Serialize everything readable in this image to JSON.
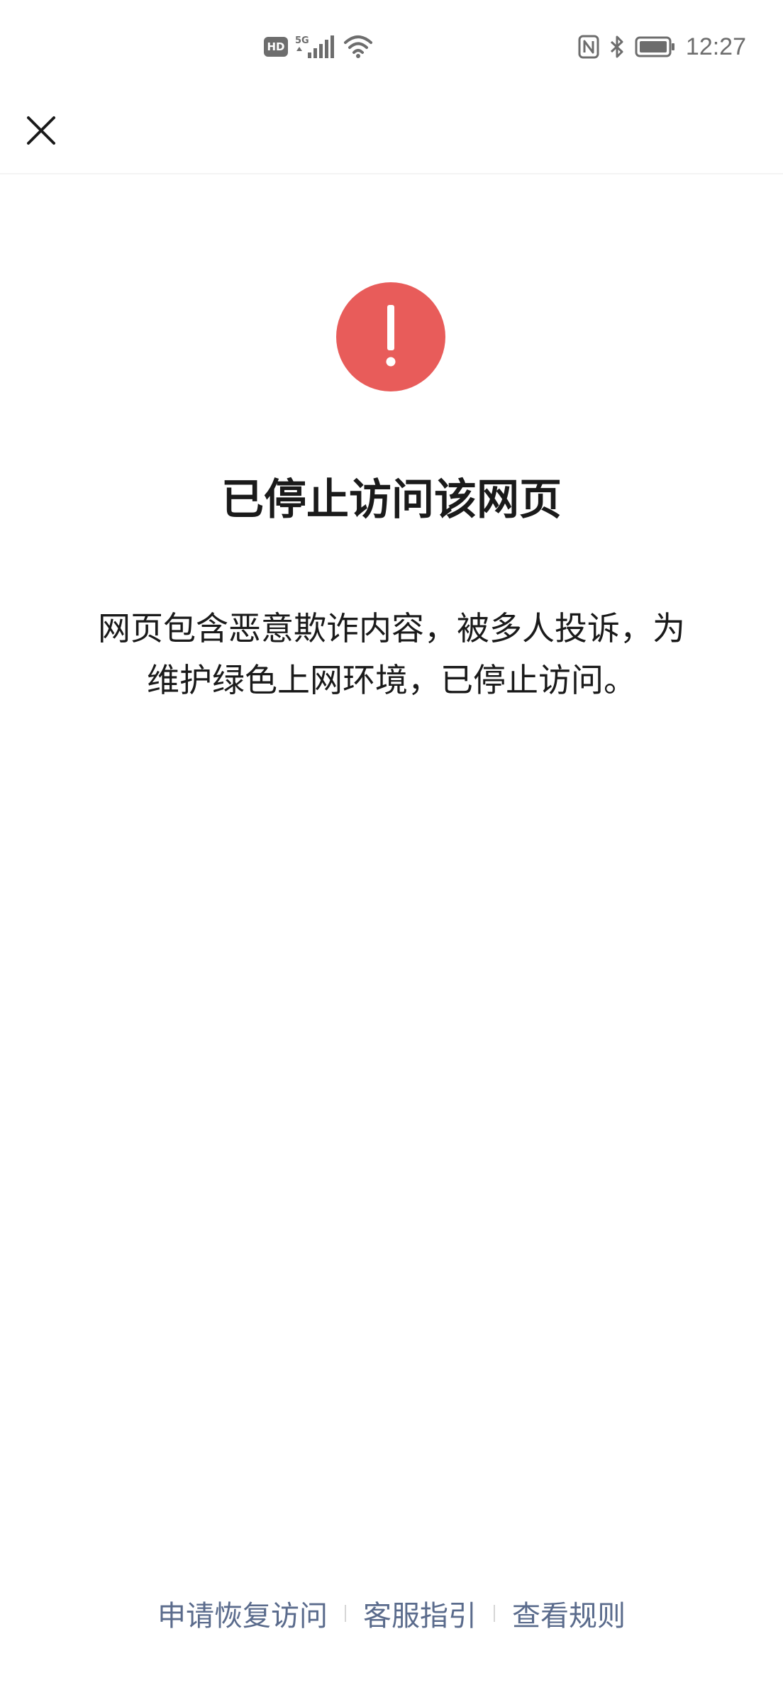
{
  "status_bar": {
    "left_icons": [
      "hd-icon",
      "signal-5g-icon",
      "wifi-icon"
    ],
    "hd_label": "HD",
    "network_label": "5G",
    "right_icons": [
      "nfc-icon",
      "bluetooth-icon",
      "battery-icon"
    ],
    "time": "12:27"
  },
  "nav": {
    "close_icon": "close-icon"
  },
  "main": {
    "warning_icon": "exclamation-icon",
    "warning_color": "#e85c5a",
    "title": "已停止访问该网页",
    "message_line1": "网页包含恶意欺诈内容，被多人投诉，为",
    "message_line2": "维护绿色上网环境，已停止访问。"
  },
  "footer": {
    "links": [
      {
        "label": "申请恢复访问"
      },
      {
        "label": "客服指引"
      },
      {
        "label": "查看规则"
      }
    ],
    "link_color": "#5a6b8c"
  }
}
